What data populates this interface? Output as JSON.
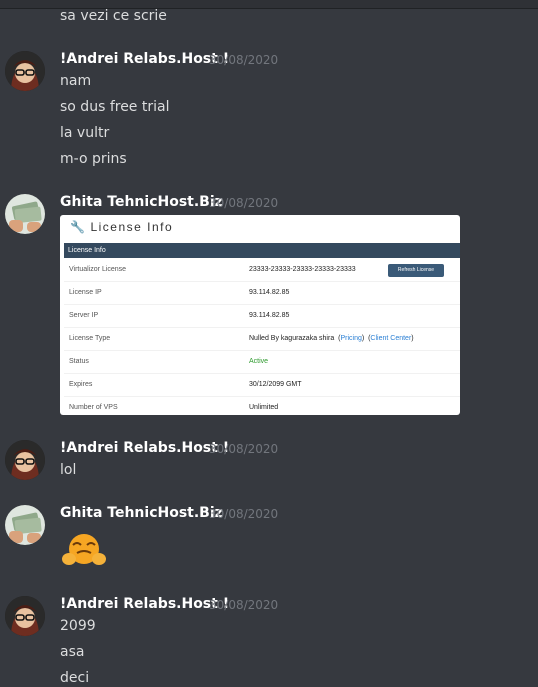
{
  "top_message": {
    "text": "sa vezi ce scrie"
  },
  "messages": [
    {
      "author": "!Andrei Relabs.Host !",
      "timestamp": "30/08/2020",
      "lines": [
        "nam",
        "so dus free trial",
        "la vultr",
        "m-o prins"
      ]
    },
    {
      "author": "Ghita TehnicHost.Biz",
      "timestamp": "30/08/2020",
      "license_card": {
        "title": "License Info",
        "header": "License Info",
        "rows": [
          {
            "label": "Virtualizor License",
            "value": "23333-23333-23333-23333-23333"
          },
          {
            "label": "License IP",
            "value": "93.114.82.85"
          },
          {
            "label": "Server IP",
            "value": "93.114.82.85"
          },
          {
            "label": "License Type",
            "value": "Nulled By kagurazaka shira"
          },
          {
            "label": "Status",
            "value": "Active"
          },
          {
            "label": "Expires",
            "value": "30/12/2099 GMT"
          },
          {
            "label": "Number of VPS",
            "value": "Unlimited"
          }
        ],
        "refresh_button": "Refresh License",
        "pricing_link": "Pricing",
        "client_center_link": "Client Center",
        "status_color": "#2e9a2e"
      }
    },
    {
      "author": "!Andrei Relabs.Host !",
      "timestamp": "30/08/2020",
      "lines": [
        "lol"
      ]
    },
    {
      "author": "Ghita TehnicHost.Biz",
      "timestamp": "30/08/2020",
      "emoji": "hot-face-emoji"
    },
    {
      "author": "!Andrei Relabs.Host !",
      "timestamp": "30/08/2020",
      "lines": [
        "2099",
        "asa",
        "deci"
      ]
    }
  ],
  "colors": {
    "background": "#36393f",
    "username": "#ffffff",
    "timestamp": "#72767d",
    "text": "#dcddde"
  }
}
